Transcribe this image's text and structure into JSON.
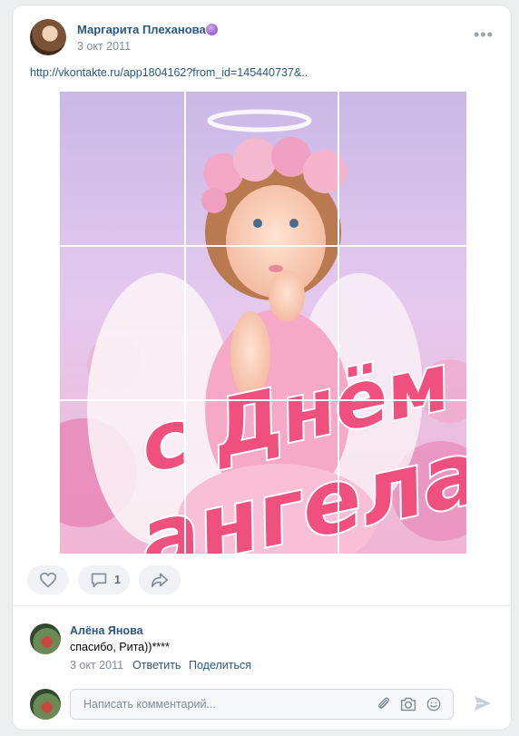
{
  "post": {
    "author": "Маргарита Плеханова",
    "date": "3 окт 2011",
    "link": "http://vkontakte.ru/app1804162?from_id=145440737&..",
    "image_text_line1": "с Днём",
    "image_text_line2": "ангела!"
  },
  "actions": {
    "comments_count": "1"
  },
  "comment": {
    "author": "Алёна Янова",
    "text": "спасибо, Рита))****",
    "date": "3 окт 2011",
    "reply_label": "Ответить",
    "share_label": "Поделиться"
  },
  "composer": {
    "placeholder": "Написать комментарий..."
  },
  "icons": {
    "more": "more-icon",
    "like": "heart-icon",
    "comment": "comment-icon",
    "share": "share-icon",
    "attach": "paperclip-icon",
    "camera": "camera-icon",
    "emoji": "smile-icon",
    "send": "send-icon"
  },
  "colors": {
    "link": "#2a5885",
    "muted": "#818c99",
    "image_text": "#f0507d"
  }
}
